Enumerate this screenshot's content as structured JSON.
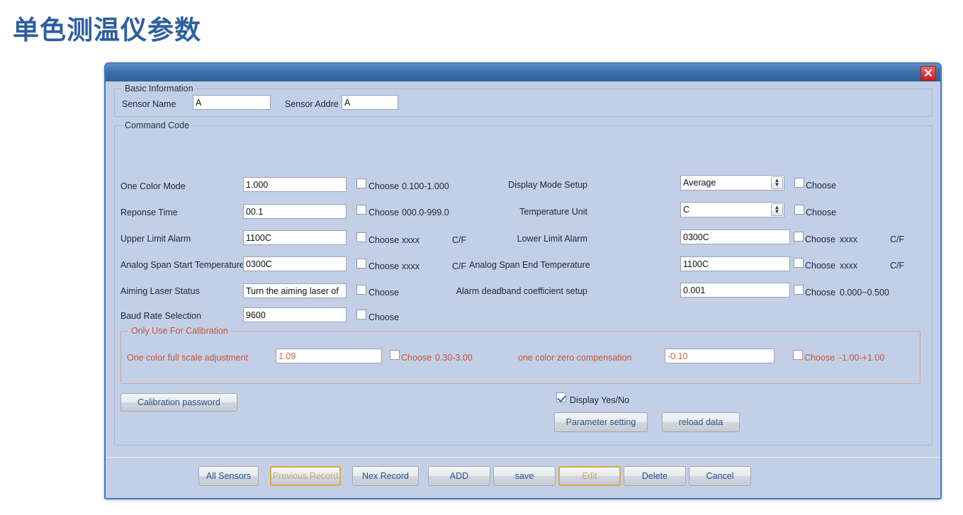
{
  "page": {
    "title": "单色测温仪参数"
  },
  "dialog": {
    "close_icon": "close-icon",
    "basic": {
      "legend": "Basic Information",
      "sensor_name_label": "Sensor Name",
      "sensor_name_value": "A",
      "sensor_addr_label": "Sensor Addre",
      "sensor_addr_value": "A"
    },
    "command": {
      "legend": "Command Code",
      "choose_label": "Choose",
      "left_rows": [
        {
          "label": "One Color Mode",
          "value": "1.000",
          "choose": "Choose",
          "range": "0.100-1.000",
          "unit": ""
        },
        {
          "label": "Reponse Time",
          "value": "00.1",
          "choose": "Choose",
          "range": "000.0-999.0",
          "unit": ""
        },
        {
          "label": "Upper Limit Alarm",
          "value": "1100C",
          "choose": "Choose",
          "range": "xxxx",
          "unit": "C/F"
        },
        {
          "label": "Analog Span Start Temperature",
          "value": "0300C",
          "choose": "Choose",
          "range": "xxxx",
          "unit": "C/F"
        },
        {
          "label": "Aiming Laser Status",
          "value": "Turn the aiming laser of",
          "choose": "Choose",
          "range": "",
          "unit": ""
        },
        {
          "label": "Baud Rate Selection",
          "value": "9600",
          "choose": "Choose",
          "range": "",
          "unit": ""
        }
      ],
      "right_rows": [
        {
          "label": "Display Mode Setup",
          "value": "Average",
          "choose": "Choose",
          "range": "",
          "unit": "",
          "type": "select"
        },
        {
          "label": "Temperature Unit",
          "value": "C",
          "choose": "Choose",
          "range": "",
          "unit": "",
          "type": "select"
        },
        {
          "label": "Lower Limit Alarm",
          "value": "0300C",
          "choose": "Choose",
          "range": "xxxx",
          "unit": "C/F",
          "type": "text"
        },
        {
          "label": "Analog Span End Temperature",
          "value": "1100C",
          "choose": "Choose",
          "range": "xxxx",
          "unit": "C/F",
          "type": "text"
        },
        {
          "label": "Alarm deadband coefficient setup",
          "value": "0.001",
          "choose": "Choose",
          "range": "0.000~0.500",
          "unit": "",
          "type": "text"
        }
      ]
    },
    "calibration": {
      "legend": "Only Use For Calibration",
      "full_scale_label": "One color full scale adjustment",
      "full_scale_value": "1.09",
      "full_scale_choose": "Choose",
      "full_scale_range": "0.30-3.00",
      "zero_comp_label": "one color zero compensation",
      "zero_comp_value": "-0.10",
      "zero_comp_choose": "Choose",
      "zero_comp_range": "-1.00-+1.00"
    },
    "actions": {
      "calibration_password": "Calibration password",
      "display_yes_no": "Display Yes/No",
      "parameter_setting": "Parameter setting",
      "reload_data": "reload data"
    },
    "footer_buttons": [
      {
        "label": "All Sensors",
        "disabled": false
      },
      {
        "label": "Previous Record",
        "disabled": true
      },
      {
        "label": "Nex Record",
        "disabled": false
      },
      {
        "label": "ADD",
        "disabled": false
      },
      {
        "label": "save",
        "disabled": false
      },
      {
        "label": "Edit",
        "disabled": true
      },
      {
        "label": "Delete",
        "disabled": false
      },
      {
        "label": "Cancel",
        "disabled": false
      }
    ]
  },
  "colors": {
    "title_blue": "#2e5f9e",
    "dialog_bg": "#c3cfe6",
    "titlebar_blue": "#3d72ad",
    "close_red": "#e23c3c",
    "calibration_red": "#c0583c",
    "button_text": "#22518c",
    "disabled_gold": "#d8a93f"
  }
}
